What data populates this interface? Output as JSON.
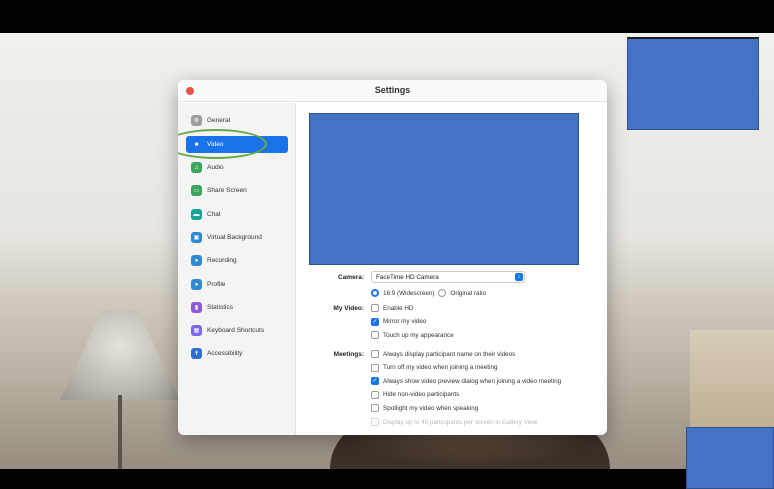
{
  "window": {
    "title": "Settings"
  },
  "sidebar": {
    "items": [
      {
        "label": "General",
        "icon": "gear-icon",
        "color": "#9e9e9e",
        "active": false
      },
      {
        "label": "Video",
        "icon": "video-camera-icon",
        "color": "#1a73e8",
        "active": true
      },
      {
        "label": "Audio",
        "icon": "headphones-icon",
        "color": "#3ba55c",
        "active": false
      },
      {
        "label": "Share Screen",
        "icon": "share-screen-icon",
        "color": "#3ba55c",
        "active": false
      },
      {
        "label": "Chat",
        "icon": "chat-bubble-icon",
        "color": "#1aa39a",
        "active": false
      },
      {
        "label": "Virtual Background",
        "icon": "image-icon",
        "color": "#2f8ad1",
        "active": false
      },
      {
        "label": "Recording",
        "icon": "record-icon",
        "color": "#2f8ad1",
        "active": false
      },
      {
        "label": "Profile",
        "icon": "person-icon",
        "color": "#2f8ad1",
        "active": false
      },
      {
        "label": "Statistics",
        "icon": "bar-chart-icon",
        "color": "#8e5bd6",
        "active": false
      },
      {
        "label": "Keyboard Shortcuts",
        "icon": "keyboard-icon",
        "color": "#7b68ee",
        "active": false
      },
      {
        "label": "Accessibility",
        "icon": "accessibility-icon",
        "color": "#2f6fd1",
        "active": false
      }
    ]
  },
  "video": {
    "camera_label": "Camera:",
    "camera_value": "FaceTime HD Camera",
    "ratio_widescreen": "16:9 (Widescreen)",
    "ratio_original": "Original ratio",
    "my_video_label": "My Video:",
    "my_video_options": [
      {
        "label": "Enable HD",
        "checked": false
      },
      {
        "label": "Mirror my video",
        "checked": true
      },
      {
        "label": "Touch up my appearance",
        "checked": false
      }
    ],
    "meetings_label": "Meetings:",
    "meetings_options": [
      {
        "label": "Always display participant name on their videos",
        "checked": false,
        "disabled": false
      },
      {
        "label": "Turn off my video when joining a meeting",
        "checked": false,
        "disabled": false
      },
      {
        "label": "Always show video preview dialog when joining a video meeting",
        "checked": true,
        "disabled": false
      },
      {
        "label": "Hide non-video participants",
        "checked": false,
        "disabled": false
      },
      {
        "label": "Spotlight my video when speaking",
        "checked": false,
        "disabled": false
      },
      {
        "label": "Display up to 49 participants per screen in Gallery View",
        "checked": false,
        "disabled": true
      }
    ]
  },
  "colors": {
    "accent": "#1a73e8",
    "placeholder_blue": "#4472c4",
    "annotation_green": "#6aa84f"
  }
}
